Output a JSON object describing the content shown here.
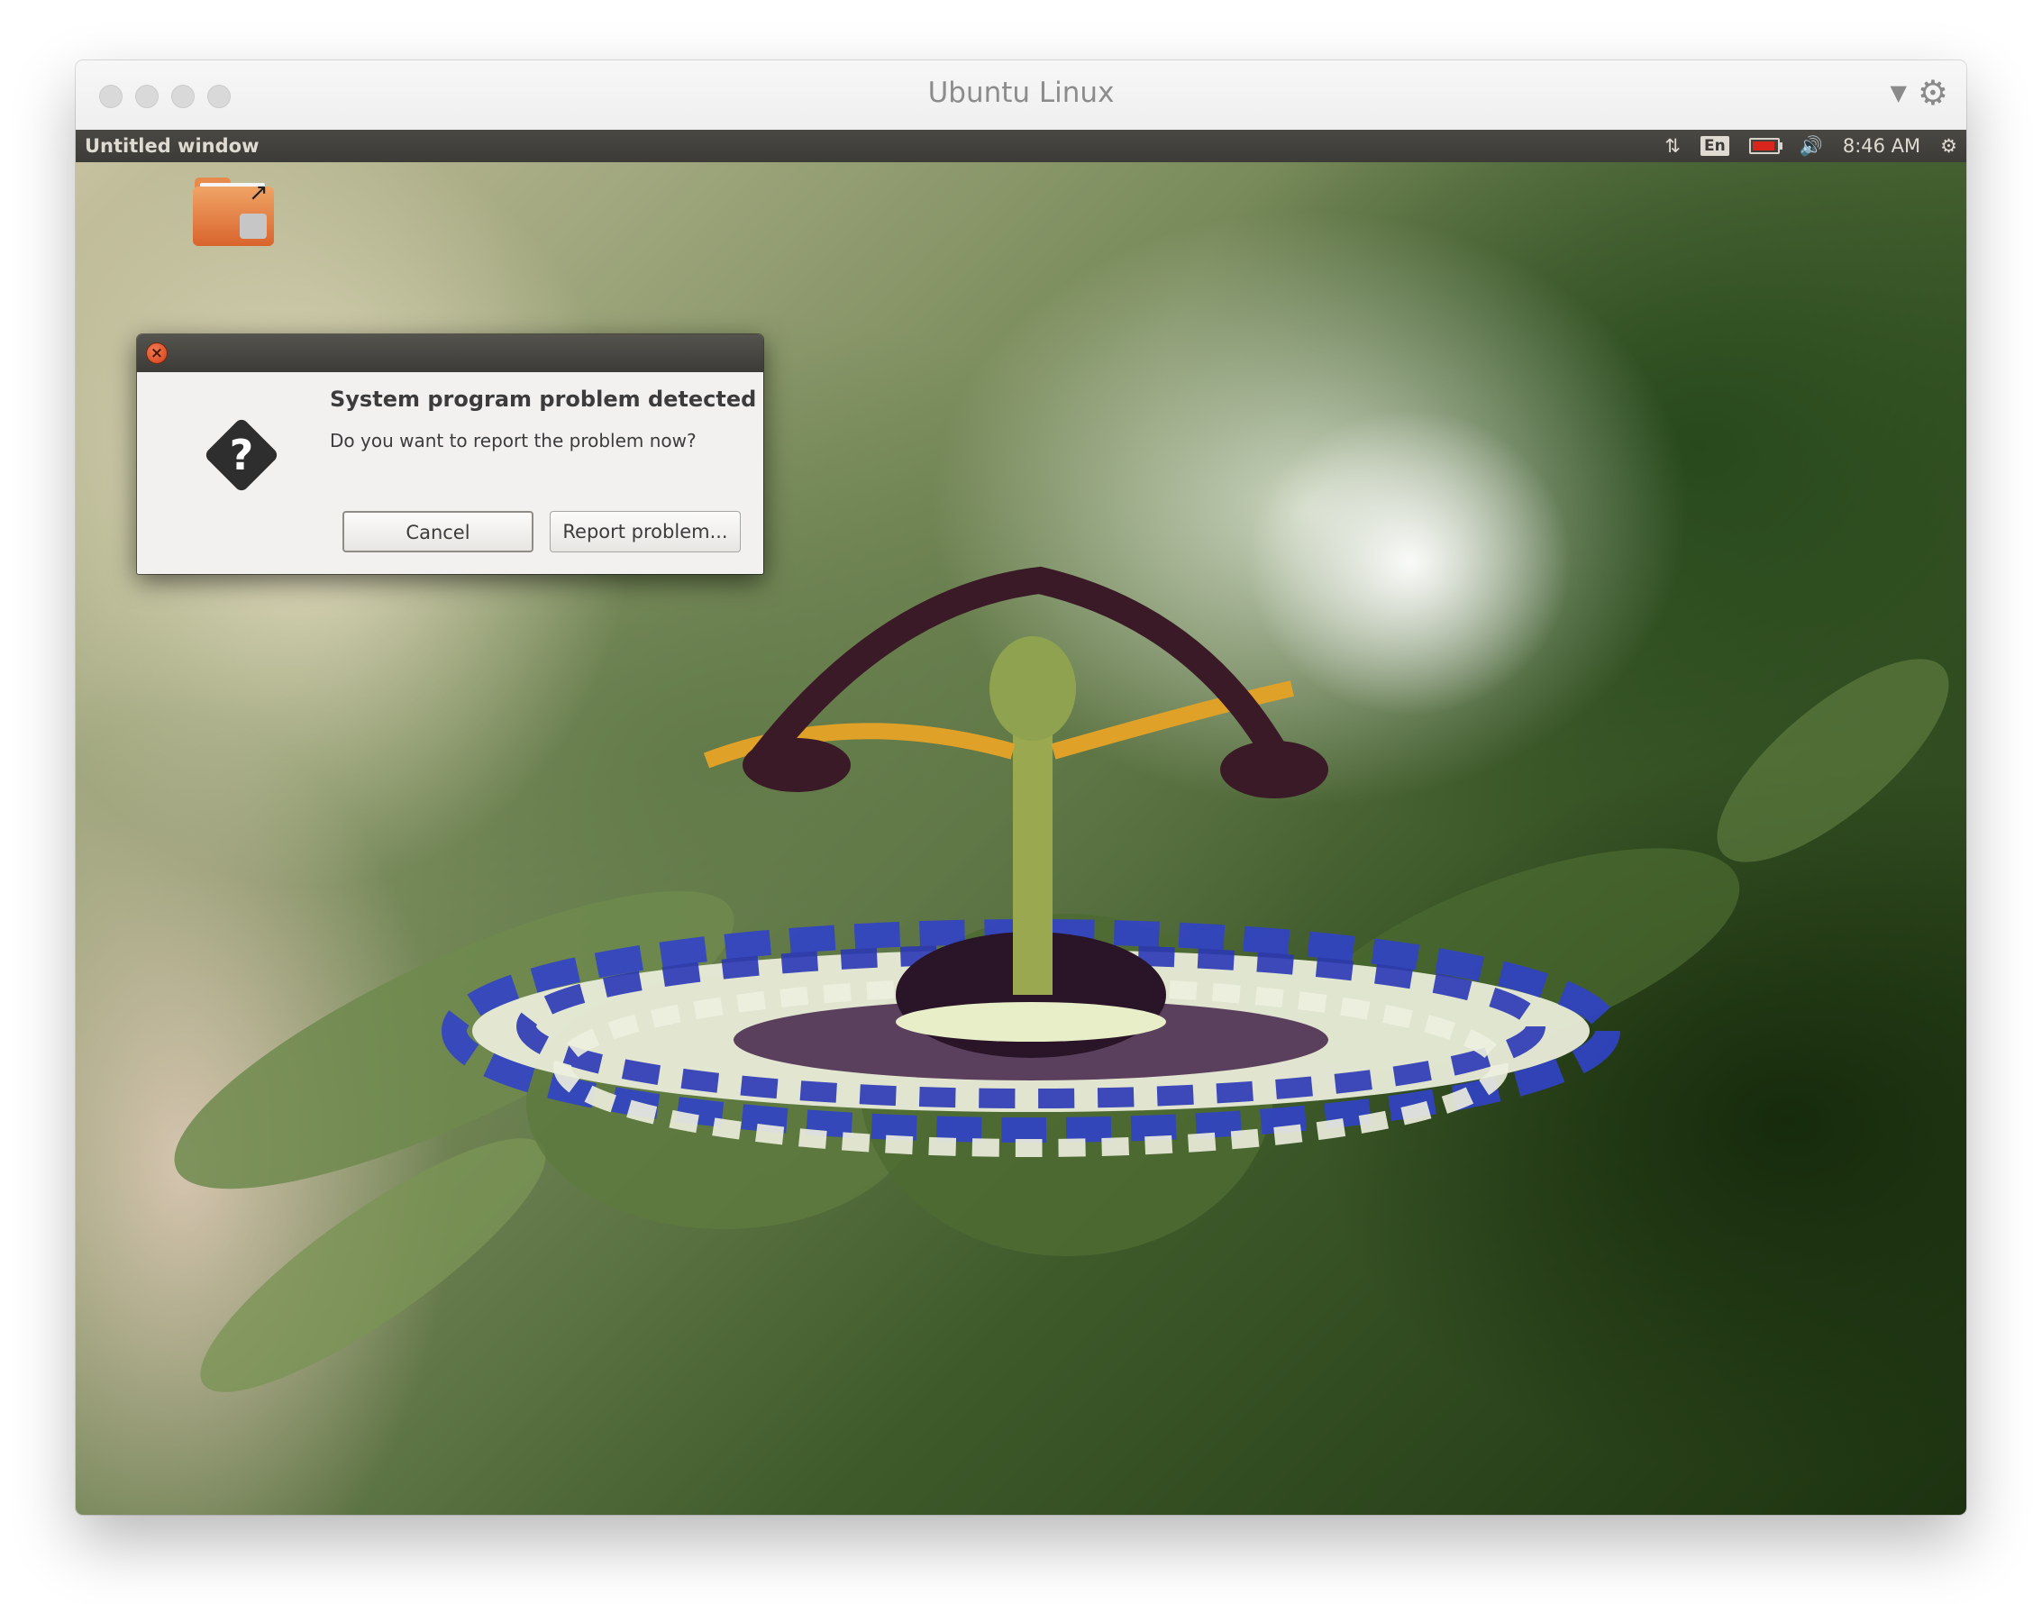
{
  "host_window": {
    "title": "Ubuntu Linux"
  },
  "ubuntu_panel": {
    "window_title": "Untitled window",
    "keyboard_layout": "En",
    "clock": "8:46 AM"
  },
  "dialog": {
    "heading": "System program problem detected",
    "message": "Do you want to report the problem now?",
    "cancel_label": "Cancel",
    "report_label": "Report problem..."
  },
  "colors": {
    "panel_bg": "#3c3b37",
    "close_button": "#e05a2b",
    "battery_indicator": "#d8261d"
  },
  "icons": [
    "gear-icon",
    "dropdown-arrow-icon",
    "network-transfer-icon",
    "battery-icon",
    "volume-icon",
    "session-gear-icon",
    "question-icon",
    "folder-icon",
    "close-icon"
  ]
}
